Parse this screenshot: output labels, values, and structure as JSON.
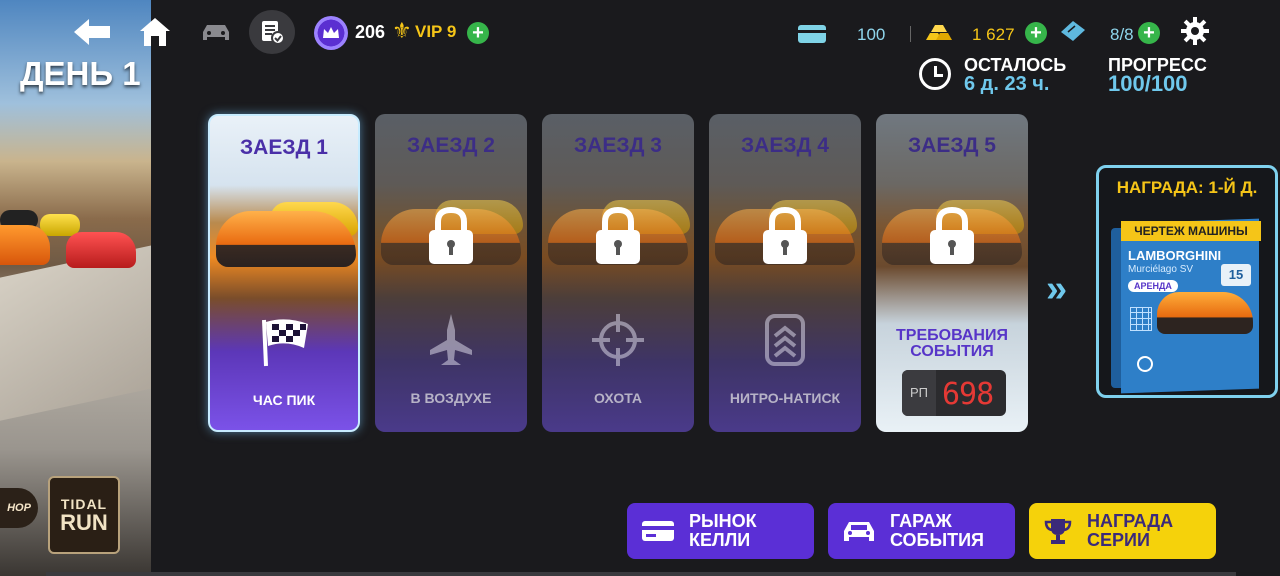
{
  "day": {
    "label": "ДЕНЬ 1"
  },
  "side_logos": {
    "shop": "HOP",
    "tidal_top": "TIDAL",
    "tidal_bottom": "RUN"
  },
  "top_bar": {
    "crown_count": "206",
    "vip_label": "VIP 9",
    "card_count": "100",
    "gold_count": "1 627",
    "ticket_count": "8/8",
    "plus_symbol": "+"
  },
  "event_status": {
    "remaining_label": "ОСТАЛОСЬ",
    "remaining_value": "6 д. 23 ч.",
    "progress_label": "ПРОГРЕСС",
    "progress_value": "100/100"
  },
  "races": [
    {
      "label": "ЗАЕЗД",
      "number": "1",
      "mode": "ЧАС ПИК",
      "mode_icon": "checkered-flag-icon",
      "locked": false
    },
    {
      "label": "ЗАЕЗД",
      "number": "2",
      "mode": "В ВОЗДУХЕ",
      "mode_icon": "jet-icon",
      "locked": true
    },
    {
      "label": "ЗАЕЗД",
      "number": "3",
      "mode": "ОХОТА",
      "mode_icon": "crosshair-icon",
      "locked": true
    },
    {
      "label": "ЗАЕЗД",
      "number": "4",
      "mode": "НИТРО-НАТИСК",
      "mode_icon": "nitro-chevrons-icon",
      "locked": true
    },
    {
      "label": "ЗАЕЗД",
      "number": "5",
      "requirements_title": "ТРЕБОВАНИЯ СОБЫТИЯ",
      "rp_label": "РП",
      "rp_value": "698",
      "locked": true
    }
  ],
  "reward": {
    "title": "НАГРАДА: 1-Й Д.",
    "banner": "ЧЕРТЕЖ МАШИНЫ",
    "make": "LAMBORGHINI",
    "model": "Murciélago SV",
    "count": "15",
    "tag": "АРЕНДА"
  },
  "buttons": {
    "kelly_market": "РЫНОК\nКЕЛЛИ",
    "event_garage": "ГАРАЖ\nСОБЫТИЯ",
    "series_reward": "НАГРАДА\nСЕРИИ"
  },
  "colors": {
    "accent_purple": "#5b2fd6",
    "accent_yellow": "#f5d20b",
    "accent_cyan": "#6fc8ec",
    "rp_red": "#e53935"
  }
}
